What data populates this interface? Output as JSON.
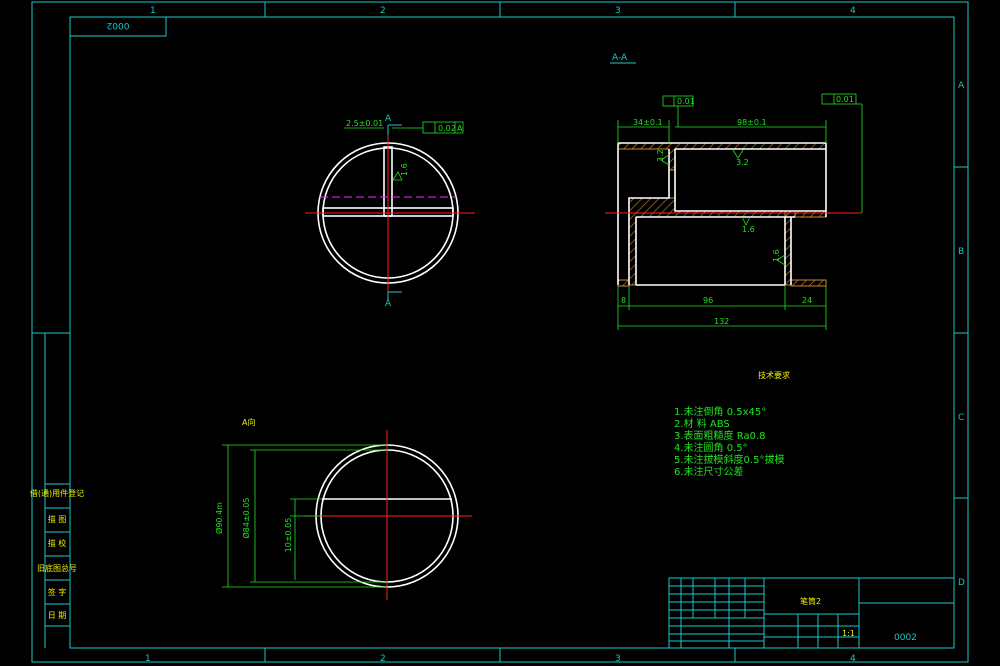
{
  "border": {
    "columns": [
      "1",
      "2",
      "3",
      "4"
    ],
    "rows": [
      "A",
      "B",
      "C",
      "D"
    ]
  },
  "drawing_number_top": "0002",
  "section_title": "A-A",
  "section_mark": "A",
  "views": {
    "front": {
      "dim_width": "2.5±0.01",
      "tolerance_frame": "0.02",
      "tolerance_datum": "A",
      "roughness": "1.6"
    },
    "section": {
      "dim_left": "34±0.1",
      "dim_right": "98±0.1",
      "parallel_tol": "0.01",
      "perp_tol": "0.01",
      "roughness_a": "3.2",
      "roughness_b": "3.2",
      "roughness_c": "1.6",
      "roughness_d": "1.6",
      "dim_8": "8",
      "dim_96": "96",
      "dim_24": "24",
      "dim_132": "132"
    },
    "bottom": {
      "label": "A向",
      "dia_outer": "Ø90.4m",
      "dia_inner": "Ø84±0.05",
      "slot": "10±0.05"
    }
  },
  "technical_requirements": {
    "title": "技术要求",
    "items": [
      "1.未注倒角 0.5x45°",
      "2.材 料 ABS",
      "3.表面粗糙度 Ra0.8",
      "4.未注圆角 0.5°",
      "5.未注拔模斜度0.5°拔模",
      "6.未注尺寸公差"
    ]
  },
  "title_block": {
    "part_name": "笔筒2",
    "scale": "1:1",
    "drawing_number": "0002",
    "left_stamps": [
      "借(通)用件登记",
      "描 图",
      "描 校",
      "旧底图总号",
      "底图总号",
      "签 字",
      "日 期"
    ]
  }
}
